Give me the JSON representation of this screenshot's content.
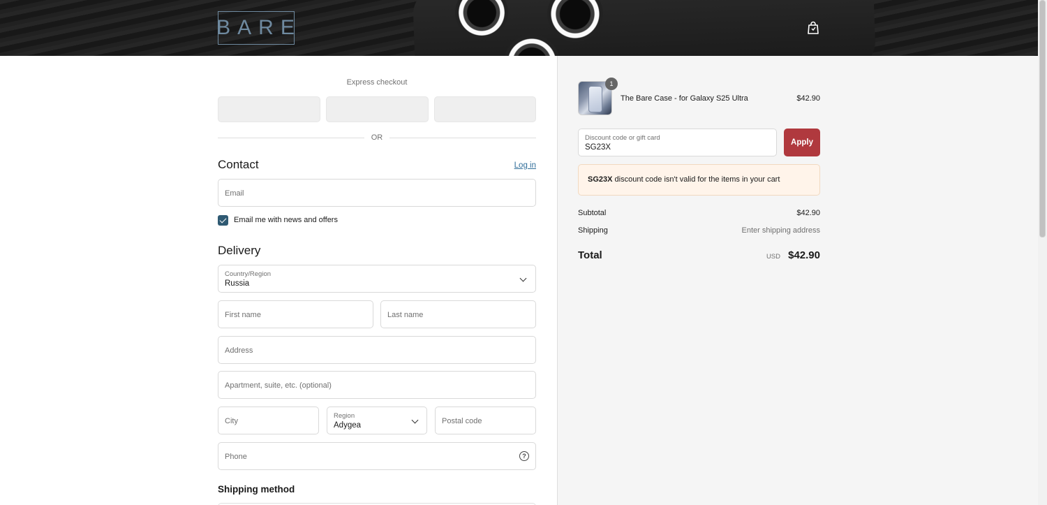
{
  "header": {
    "logo_text": "BARE"
  },
  "express": {
    "title": "Express checkout",
    "or_text": "OR"
  },
  "contact": {
    "title": "Contact",
    "login_link": "Log in",
    "email_placeholder": "Email",
    "newsletter_label": "Email me with news and offers",
    "newsletter_checked": true
  },
  "delivery": {
    "title": "Delivery",
    "country_label": "Country/Region",
    "country_value": "Russia",
    "first_name_placeholder": "First name",
    "last_name_placeholder": "Last name",
    "address_placeholder": "Address",
    "apartment_placeholder": "Apartment, suite, etc. (optional)",
    "city_placeholder": "City",
    "region_label": "Region",
    "region_value": "Adygea",
    "postal_placeholder": "Postal code",
    "phone_placeholder": "Phone",
    "help_glyph": "?"
  },
  "shipping_method": {
    "title": "Shipping method"
  },
  "summary": {
    "item": {
      "quantity": "1",
      "name": "The Bare Case - for Galaxy S25 Ultra",
      "price": "$42.90"
    },
    "discount": {
      "label": "Discount code or gift card",
      "value": "SG23X",
      "apply_label": "Apply"
    },
    "alert": {
      "code": "SG23X",
      "message": " discount code isn't valid for the items in your cart"
    },
    "subtotal_label": "Subtotal",
    "subtotal_value": "$42.90",
    "shipping_label": "Shipping",
    "shipping_value": "Enter shipping address",
    "total_label": "Total",
    "currency": "USD",
    "total_value": "$42.90"
  },
  "colors": {
    "accent": "#b0393e",
    "checkbox": "#2f5a73",
    "link": "#2f6d99",
    "alert_bg": "#fff4ea"
  }
}
